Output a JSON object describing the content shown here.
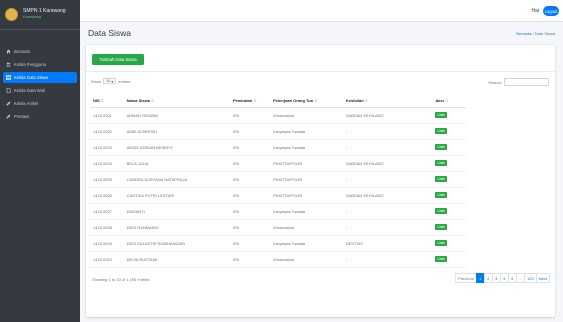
{
  "brand": {
    "title": "SMPN 1 Karawang",
    "subtitle": "Karawang"
  },
  "sidebar": {
    "items": [
      {
        "label": "Beranda",
        "icon": "home-icon",
        "active": false
      },
      {
        "label": "Kelola Pengguna",
        "icon": "users-icon",
        "active": false
      },
      {
        "label": "Kelola Data Siswa",
        "icon": "table-icon",
        "active": true
      },
      {
        "label": "Kelola Data Wali",
        "icon": "file-icon",
        "active": false
      },
      {
        "label": "Kelola Artikel",
        "icon": "edit-icon",
        "active": false
      },
      {
        "label": "Prestasi",
        "icon": "edit-icon",
        "active": false
      }
    ]
  },
  "topbar": {
    "user": "Hai",
    "logout_label": "Logout"
  },
  "header": {
    "title": "Data Siswa",
    "breadcrumb_home": "Beranda",
    "breadcrumb_sep": "/",
    "breadcrumb_current": "Data Siswa"
  },
  "toolbar": {
    "add_label": "Tambah Data Siswa"
  },
  "entries": {
    "show": "Show",
    "value": "10",
    "suffix": "entries"
  },
  "search": {
    "label": "Search:"
  },
  "table": {
    "columns": [
      "NIS",
      "Nama Siswa",
      "Pemiratan",
      "Pekerjaan Orang Tua",
      "Kesibilan",
      "Aksi"
    ],
    "rows": [
      [
        "1415.0001",
        "AHMAD RIDWAN",
        "IPA",
        "Wiraswasta",
        "SABDAN SEHILANG",
        "Ubah"
      ],
      [
        "1415.0002",
        "AMELIA BERSIH",
        "IPA",
        "Karyawan Swasta",
        "-",
        "Ubah"
      ],
      [
        "1415.0003",
        "ANGIE ADRIAN BENEFIT",
        "IPA",
        "Karyawan Swasta",
        "-",
        "Ubah"
      ],
      [
        "1415.0004",
        "BELA JULIA",
        "IPA",
        "PNS/TNI/POLRI",
        "SABDAN SEHILANG",
        "Ubah"
      ],
      [
        "1415.0005",
        "CANDRA SURYANA NATAPRAJA",
        "IPA",
        "PNS/TNI/POLRI",
        "-",
        "Ubah"
      ],
      [
        "1415.0006",
        "CANTIKA PUTRI LESTARI",
        "IPA",
        "PNS/TNI/POLRI",
        "SABDAN SEHILANG",
        "Ubah"
      ],
      [
        "1415.0007",
        "DAVIANTI",
        "IPA",
        "Karyawan Swasta",
        "-",
        "Ubah"
      ],
      [
        "1415.0008",
        "DEDI RAHMANDI",
        "IPA",
        "Wiraswasta",
        "-",
        "Ubah"
      ],
      [
        "1415.0009",
        "DESI SULASTRI SUBIHANDARI",
        "IPA",
        "Karyawan Swasta",
        "DESTINY",
        "Ubah"
      ],
      [
        "1415.0010",
        "DEVIA RUSTAMI",
        "IPA",
        "Wiraswasta",
        "-",
        "Ubah"
      ]
    ]
  },
  "info": "Showing 1 to 10 of 1,195 entries",
  "pagination": {
    "previous": "Previous",
    "pages": [
      "1",
      "2",
      "3",
      "4",
      "5",
      "...",
      "120"
    ],
    "next": "Next",
    "active": "1"
  }
}
